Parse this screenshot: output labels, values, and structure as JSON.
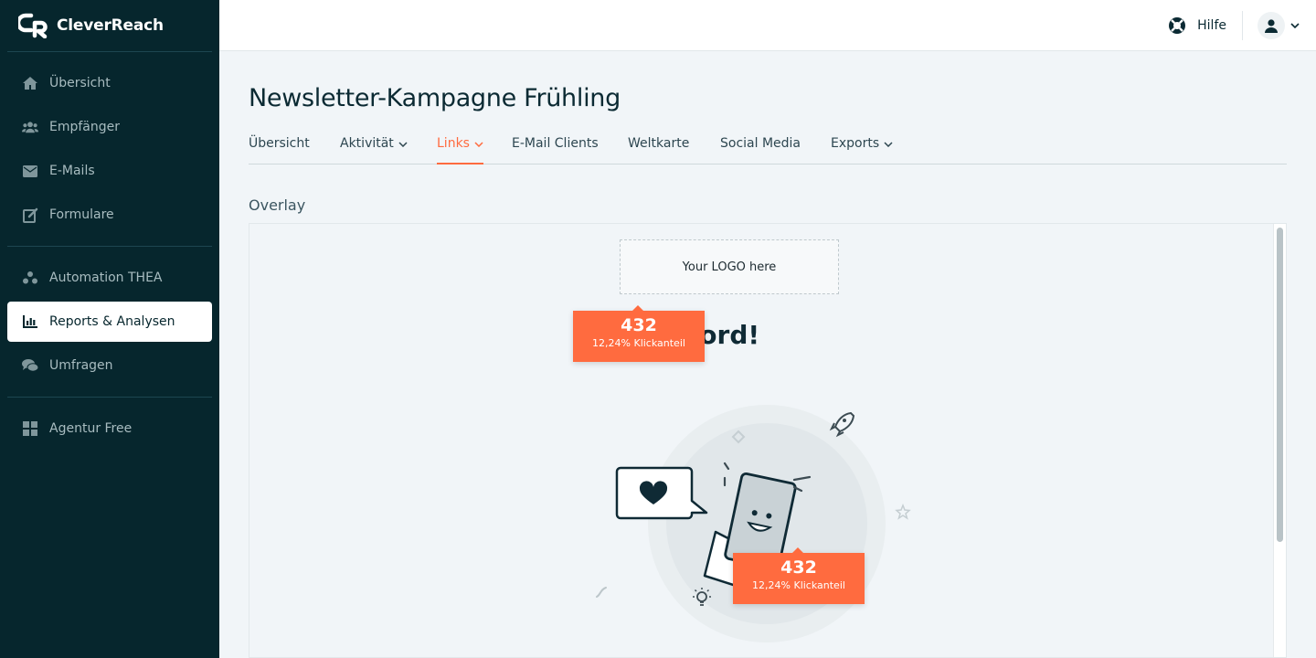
{
  "brand": {
    "name": "CleverReach"
  },
  "sidebar": {
    "items": [
      {
        "label": "Übersicht",
        "icon": "home-icon"
      },
      {
        "label": "Empfänger",
        "icon": "users-icon"
      },
      {
        "label": "E-Mails",
        "icon": "envelope-icon"
      },
      {
        "label": "Formulare",
        "icon": "edit-form-icon"
      },
      {
        "label": "Automation THEA",
        "icon": "automation-icon"
      },
      {
        "label": "Reports & Analysen",
        "icon": "bar-chart-icon",
        "active": true
      },
      {
        "label": "Umfragen",
        "icon": "chat-bubbles-icon"
      },
      {
        "label": "Agentur Free",
        "icon": "grid-icon"
      }
    ]
  },
  "topbar": {
    "help_label": "Hilfe"
  },
  "page": {
    "title": "Newsletter-Kampagne Frühling"
  },
  "tabs": [
    {
      "label": "Übersicht"
    },
    {
      "label": "Aktivität"
    },
    {
      "label": "Links",
      "active": true
    },
    {
      "label": "E-Mail Clients"
    },
    {
      "label": "Weltkarte"
    },
    {
      "label": "Social Media"
    },
    {
      "label": "Exports"
    }
  ],
  "overlay": {
    "section_label": "Overlay",
    "logo_placeholder": "Your LOGO here",
    "headline_visible": "l the word!",
    "badges": [
      {
        "count": "432",
        "share": "12,24% Klickanteil"
      },
      {
        "count": "432",
        "share": "12,24% Klickanteil"
      }
    ]
  },
  "colors": {
    "sidebar_bg": "#06262d",
    "accent": "#ff6b3f",
    "page_bg": "#f1f5f8"
  }
}
